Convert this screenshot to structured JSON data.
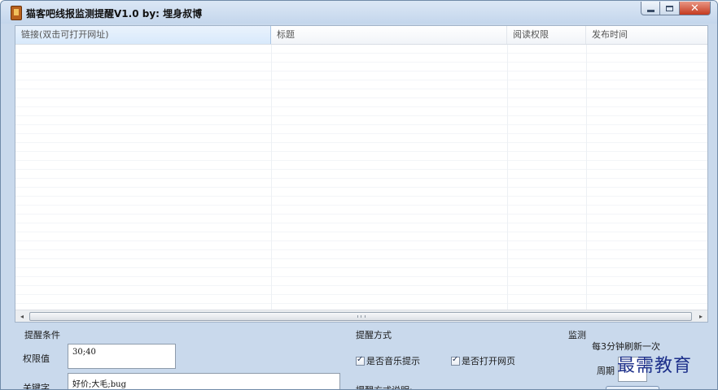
{
  "window": {
    "title": "猫客吧线报监测提醒V1.0 by: 埋身叔博",
    "close_glyph": "✕"
  },
  "list": {
    "columns": [
      "链接(双击可打开网址)",
      "标题",
      "阅读权限",
      "发布时间"
    ]
  },
  "scrollbar": {
    "left_arrow": "◂",
    "right_arrow": "▸"
  },
  "conditions": {
    "group_title": "提醒条件",
    "permission_label": "权限值",
    "permission_value": "30;40",
    "keyword_label": "关键字",
    "keyword_value": "好价;大毛;bug"
  },
  "remind_mode": {
    "group_title": "提醒方式",
    "music_label": "是否音乐提示",
    "music_checked": true,
    "webpage_label": "是否打开网页",
    "webpage_checked": true,
    "explain_label": "提醒方式说明:"
  },
  "monitor": {
    "group_title": "监测",
    "refresh_text": "每3分钟刷新一次",
    "period_label": "周期",
    "period_value": ""
  },
  "watermark": {
    "text": "最需教育"
  }
}
